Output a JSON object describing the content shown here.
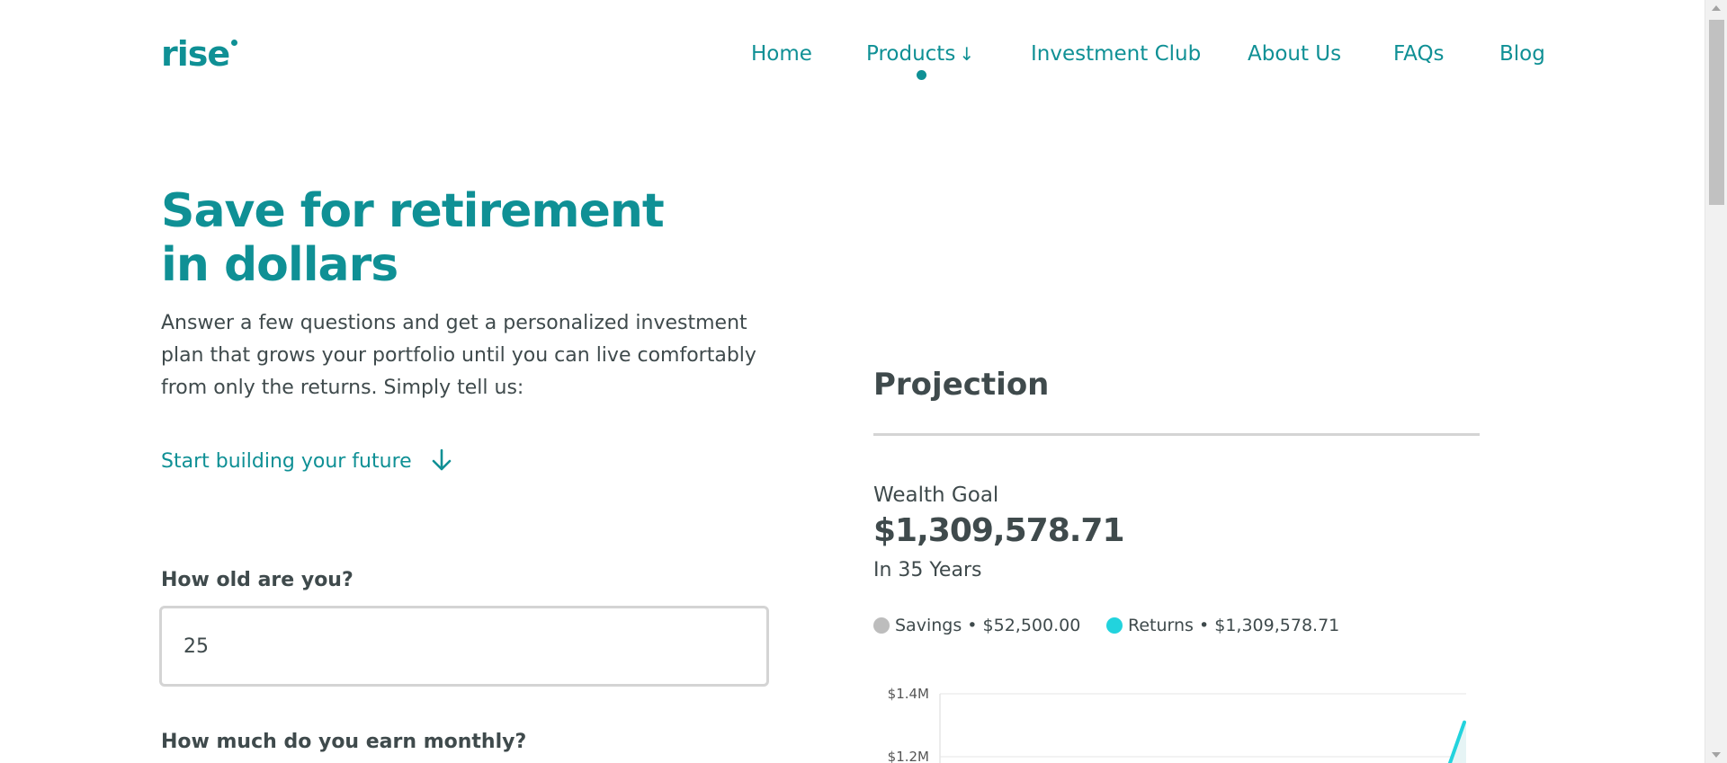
{
  "header": {
    "logo_text": "rise",
    "nav": [
      {
        "label": "Home"
      },
      {
        "label": "Products",
        "arrow": "↓",
        "active": true
      },
      {
        "label": "Investment Club"
      },
      {
        "label": "About Us"
      },
      {
        "label": "FAQs"
      },
      {
        "label": "Blog"
      }
    ]
  },
  "hero": {
    "title": "Save for retirement in dollars",
    "description": "Answer a few questions and get a personalized investment plan that grows your portfolio until you can live comfortably from only the returns. Simply tell us:",
    "cta_label": "Start building your future",
    "cta_icon": "arrow-down-icon"
  },
  "form": {
    "age_question": "How old are you?",
    "age_value": "25",
    "income_question": "How much do you earn monthly?"
  },
  "projection": {
    "title": "Projection",
    "wealth_goal_label": "Wealth Goal",
    "wealth_goal_value": "$1,309,578.71",
    "horizon": "In 35 Years",
    "legend": [
      {
        "name": "Savings",
        "value": "$52,500.00",
        "color": "#bdbdbd"
      },
      {
        "name": "Returns",
        "value": "$1,309,578.71",
        "color": "#22d3dd"
      }
    ]
  },
  "colors": {
    "brand": "#0f9095",
    "text": "#3f4a4c",
    "returns": "#22d3dd",
    "savings": "#bdbdbd"
  },
  "chart_data": {
    "type": "area",
    "title": "",
    "xlabel": "",
    "ylabel": "",
    "y_ticks": [
      "$1.4M",
      "$1.2M"
    ],
    "ylim": [
      1200000,
      1400000
    ],
    "series": [
      {
        "name": "Savings",
        "values": [
          52500
        ]
      },
      {
        "name": "Returns",
        "values": [
          1309578.71
        ]
      }
    ],
    "grid": true
  }
}
